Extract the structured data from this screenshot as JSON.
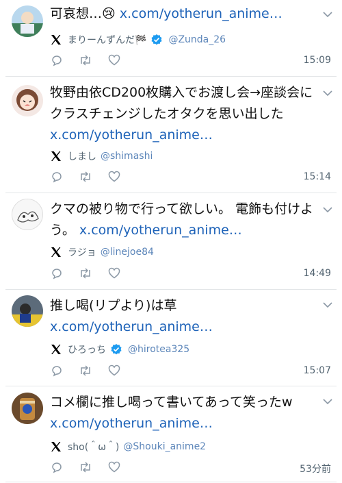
{
  "posts": [
    {
      "text": "可哀想…😢 ",
      "link": "x.com/yotherun_anime…",
      "name": "まりーんずんだ🏁",
      "verified": true,
      "handle": "@Zunda_26",
      "time": "15:09"
    },
    {
      "text": "牧野由依CD200枚購入でお渡し会→座談会にクラスチェンジしたオタクを思い出した",
      "link": "x.com/yotherun_anime…",
      "name": "しまし",
      "verified": false,
      "handle": "@shimashi",
      "time": "15:14"
    },
    {
      "text": "クマの被り物で行って欲しい。 電飾も付けよう。 ",
      "link": "x.com/yotherun_anime…",
      "name": "ラジョ",
      "verified": false,
      "handle": "@linejoe84",
      "time": "14:49"
    },
    {
      "text": "推し喝(リプより)は草",
      "link": "x.com/yotherun_anime…",
      "name": "ひろっち",
      "verified": true,
      "handle": "@hirotea325",
      "time": "15:07"
    },
    {
      "text": "コメ欄に推し喝って書いてあって笑ったw",
      "link": "x.com/yotherun_anime…",
      "name": "sho(＾ω＾)",
      "verified": false,
      "handle": "@Shouki_anime2",
      "time": "53分前"
    }
  ],
  "colors": {
    "link": "#1d62b8",
    "verified": "#1d9bf0",
    "muted": "#536471"
  }
}
